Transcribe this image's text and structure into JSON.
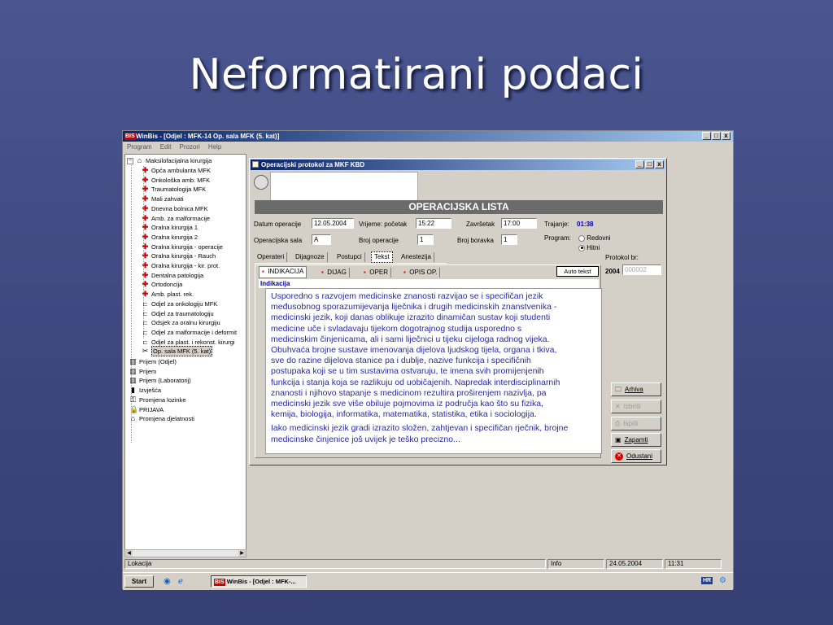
{
  "slide": {
    "title": "Neformatirani podaci"
  },
  "app": {
    "logo": "BIS",
    "title": "WinBis - [Odjel : MFK-14 Op. sala MFK (5. kat)]",
    "menu": [
      "Program",
      "Edit",
      "Prozori",
      "Help"
    ],
    "caption_buttons": [
      "_",
      "□",
      "x"
    ]
  },
  "tree": {
    "root": "Maksilofacijalna kirurgija",
    "items": [
      {
        "label": "Opća ambulanta MFK",
        "icon": "red-cross-icon"
      },
      {
        "label": "Onkološka amb. MFK",
        "icon": "red-cross-icon"
      },
      {
        "label": "Traumatologija MFK",
        "icon": "red-cross-icon"
      },
      {
        "label": "Mali zahvati",
        "icon": "red-cross-icon"
      },
      {
        "label": "Dnevna bolnica MFK",
        "icon": "red-cross-icon"
      },
      {
        "label": "Amb. za malformacije",
        "icon": "red-cross-icon"
      },
      {
        "label": "Oralna kirurgija 1",
        "icon": "red-cross-icon"
      },
      {
        "label": "Oralna kirurgija 2",
        "icon": "red-cross-icon"
      },
      {
        "label": "Oralna kirurgija - operacije",
        "icon": "red-cross-icon"
      },
      {
        "label": "Oralna kirurgija - Rauch",
        "icon": "red-cross-icon"
      },
      {
        "label": "Oralna kirurgija - kir. prot.",
        "icon": "red-cross-icon"
      },
      {
        "label": "Dentalna patologija",
        "icon": "red-cross-icon"
      },
      {
        "label": "Ortodoncija",
        "icon": "red-cross-icon"
      },
      {
        "label": "Amb. plast. rek.",
        "icon": "red-cross-icon"
      },
      {
        "label": "Odjel za onkologiju MFK",
        "icon": "bed-icon"
      },
      {
        "label": "Odjel za traumatologiju",
        "icon": "bed-icon"
      },
      {
        "label": "Odsjek za oralnu kirurgiju",
        "icon": "bed-icon"
      },
      {
        "label": "Odjel za malformacije i deformit",
        "icon": "bed-icon"
      },
      {
        "label": "Odjel za plast. i rekonst. kirurgi",
        "icon": "bed-icon"
      },
      {
        "label": "Op. sala MFK (5. kat)",
        "icon": "scissors-icon"
      }
    ],
    "bottom_items": [
      {
        "label": "Prijem (Odjel)",
        "icon": "building-icon"
      },
      {
        "label": "Prijem",
        "icon": "building-icon"
      },
      {
        "label": "Prijem (Laboratorij)",
        "icon": "building-icon"
      },
      {
        "label": "Izvješća",
        "icon": "chart-icon"
      },
      {
        "label": "Promjena lozinke",
        "icon": "key-icon"
      },
      {
        "label": "PRIJAVA",
        "icon": "lock-icon"
      },
      {
        "label": "Promjena djelatnosti",
        "icon": "house-icon"
      }
    ]
  },
  "statusbar": {
    "left": "Lokacija",
    "info": "Info",
    "date": "24.05.2004",
    "time": "11:31"
  },
  "taskbar": {
    "start": "Start",
    "task_logo": "BIS",
    "task": "WinBis - [Odjel : MFK-...",
    "tray": "HR"
  },
  "dialog": {
    "title": "Operacijski protokol za MKF KBD",
    "caption_buttons": [
      "_",
      "□",
      "x"
    ],
    "header": "OPERACIJSKA LISTA",
    "fields": {
      "datum_label": "Datum operacije",
      "datum": "12.05.2004",
      "vrijeme_label": "Vrijeme: početak",
      "vrijeme": "15:22",
      "zavrsetak_label": "Završetak",
      "zavrsetak": "17:00",
      "trajanje_label": "Trajanje:",
      "trajanje": "01:38",
      "sala_label": "Operacijska sala",
      "sala": "A",
      "broj_op_label": "Broj operacije",
      "broj_op": "1",
      "broj_bor_label": "Broj boravka",
      "broj_bor": "1",
      "program_label": "Program:",
      "program_options": [
        "Redovni",
        "Hitni"
      ],
      "program_selected": "Hitni",
      "protokol_label": "Protokol br:",
      "protokol_year": "2004",
      "protokol_no": "000002"
    },
    "tabs": [
      "Operateri",
      "Dijagnoze",
      "Postupci",
      "Tekst",
      "Anestezija"
    ],
    "active_tab": "Tekst",
    "subtabs": [
      "INDIKACIJA",
      "DIJAG",
      "OPER",
      "OPIS OP."
    ],
    "auto_tekst": "Auto tekst",
    "section_label": "Indikacija",
    "text_lines_1": [
      "Usporedno s razvojem medicinske znanosti razvijao se i specifičan jezik",
      "međusobnog sporazumijevanja liječnika i drugih medicinskih znanstvenika -",
      "medicinski jezik, koji danas oblikuje izrazito dinamičan sustav koji studenti",
      "medicine uče i svladavaju tijekom dogotrajnog studija usporedno s",
      "medicinskim činjenicama, ali i sami liječnici u tijeku cijeloga radnog vijeka.",
      "Obuhvaća brojne sustave imenovanja dijelova ljudskog tijela, organa i tkiva,",
      "sve do razine dijelova stanice pa i dublje, nazive funkcija i specifičnih",
      "postupaka koji se u tim sustavima ostvaruju, te imena svih promijenjenih",
      "funkcija i stanja koja se razlikuju od uobičajenih. Napredak interdisciplinarnih",
      "znanosti i njihovo stapanje s medicinom rezultira proširenjem nazivlja, pa",
      "medicinski jezik sve više obiluje pojmovima iz područja kao što su fizika,",
      "kemija, biologija, informatika, matematika, statistika, etika i sociologija."
    ],
    "text_lines_2": [
      "Iako medicinski jezik gradi izrazito složen, zahtjevan i specifičan rječnik, brojne",
      "medicinske činjenice još uvijek je teško precizno..."
    ],
    "buttons": {
      "arhiva": "Arhiva",
      "izbrisi": "Izbriši",
      "ispisi": "Ispiši",
      "zapamti": "Zapamti",
      "odustani": "Odustani"
    }
  }
}
